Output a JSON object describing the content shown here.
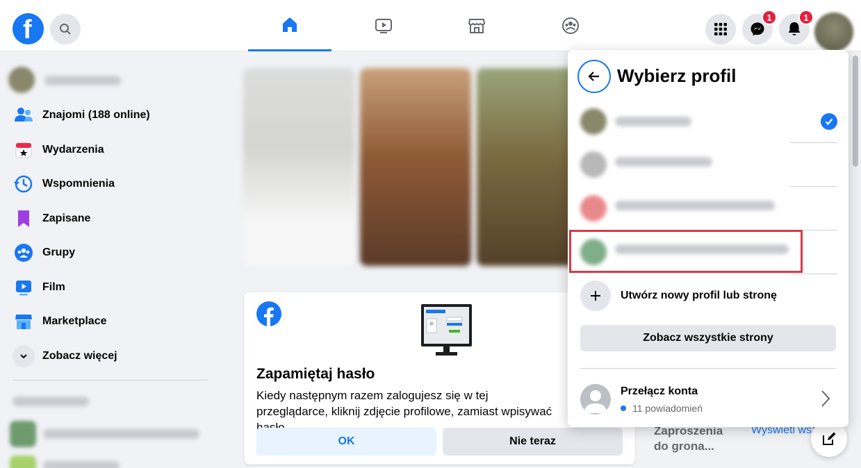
{
  "topbar": {
    "logo": "facebook-logo",
    "search_icon": "search-icon",
    "tabs": [
      {
        "name": "home",
        "icon": "home-icon",
        "active": true
      },
      {
        "name": "watch",
        "icon": "video-icon",
        "active": false
      },
      {
        "name": "marketplace",
        "icon": "store-icon",
        "active": false
      },
      {
        "name": "groups",
        "icon": "groups-icon",
        "active": false
      }
    ],
    "menu_icon": "grid-menu-icon",
    "messenger_badge": "1",
    "notifications_badge": "1"
  },
  "sidebar": {
    "items": [
      {
        "label": "Znajomi (188 online)",
        "icon": "friends-icon"
      },
      {
        "label": "Wydarzenia",
        "icon": "calendar-icon"
      },
      {
        "label": "Wspomnienia",
        "icon": "clock-icon"
      },
      {
        "label": "Zapisane",
        "icon": "bookmark-icon"
      },
      {
        "label": "Grupy",
        "icon": "groups-icon"
      },
      {
        "label": "Film",
        "icon": "video-icon"
      },
      {
        "label": "Marketplace",
        "icon": "store-icon"
      },
      {
        "label": "Zobacz więcej",
        "icon": "chevron-down-icon"
      }
    ]
  },
  "card": {
    "title": "Zapamiętaj hasło",
    "text": "Kiedy następnym razem zalogujesz się w tej przeglądarce, kliknij zdjęcie profilowe, zamiast wpisywać hasło.",
    "ok_label": "OK",
    "not_now_label": "Nie teraz"
  },
  "right_column": {
    "heading": "Zaproszenia do grona...",
    "link": "Wyświetl wsz"
  },
  "panel": {
    "title": "Wybierz profil",
    "create_label": "Utwórz nowy profil lub stronę",
    "see_all_label": "Zobacz wszystkie strony",
    "switch_title": "Przełącz konta",
    "switch_sub": "11 powiadomień"
  },
  "colors": {
    "brand": "#1877f2",
    "badge": "#e41e3f",
    "highlight": "#d83a47"
  }
}
